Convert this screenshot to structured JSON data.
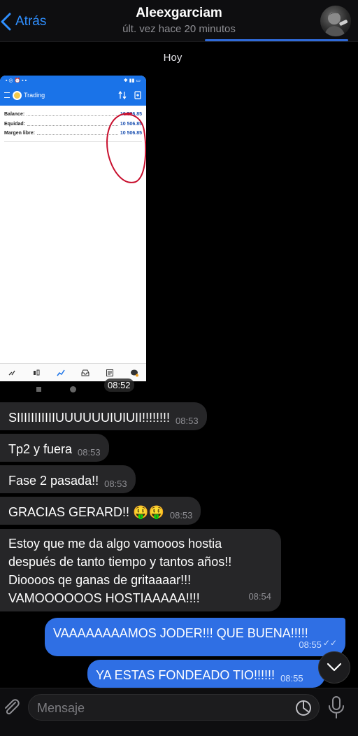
{
  "header": {
    "back_label": "Atrás",
    "chat_name": "Aleexgarciam",
    "status": "últ. vez hace 20 minutos"
  },
  "date_label": "Hoy",
  "image_message": {
    "time": "08:52",
    "app_title": "Trading",
    "rows": [
      {
        "label": "Balance:",
        "value": "10 506.85"
      },
      {
        "label": "Equidad:",
        "value": "10 506.85"
      },
      {
        "label": "Margen libre:",
        "value": "10 506.85"
      }
    ],
    "annotation_color": "#c8102e"
  },
  "messages_in": [
    {
      "text": "SIIIIIIIIIIIUUUUUUIUIUII!!!!!!!!",
      "time": "08:53"
    },
    {
      "text": "Tp2 y fuera",
      "time": "08:53"
    },
    {
      "text": "Fase 2 pasada!!",
      "time": "08:53"
    },
    {
      "text": "GRACIAS GERARD!! 🤑🤑",
      "time": "08:53"
    },
    {
      "lines": [
        "Estoy que me da algo vamooos hostia",
        "después de tanto tiempo y tantos años!!",
        "Dioooos qe ganas de gritaaaar!!!",
        "VAMOOOOOOS HOSTIAAAAA!!!!"
      ],
      "time": "08:54"
    }
  ],
  "messages_out": [
    {
      "text": "VAAAAAAAAMOS JODER!!! QUE BUENA!!!!!",
      "time": "08:55",
      "status": "read"
    },
    {
      "text": "YA ESTAS FONDEADO TIO!!!!!!",
      "time": "08:55",
      "status": "read"
    }
  ],
  "composer": {
    "placeholder": "Mensaje"
  },
  "colors": {
    "accent": "#2f8fff",
    "outgoing_bubble": "#2f6fe4",
    "incoming_bubble": "#262628"
  }
}
